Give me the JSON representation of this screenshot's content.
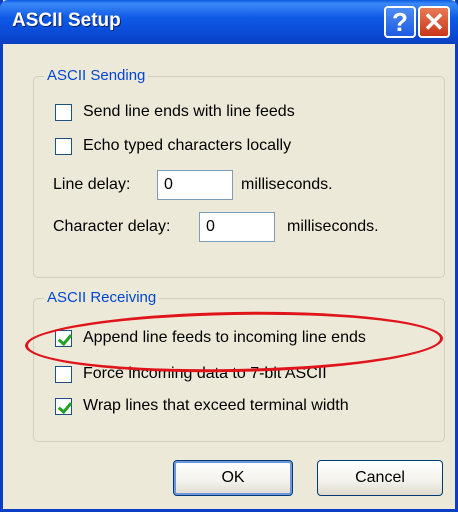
{
  "window": {
    "title": "ASCII Setup"
  },
  "titlebar": {
    "help_glyph": "?",
    "close_glyph": "✕"
  },
  "sending": {
    "legend": "ASCII Sending",
    "send_line_ends": {
      "label": "Send line ends with line feeds",
      "checked": false
    },
    "echo_typed": {
      "label": "Echo typed characters locally",
      "checked": false
    },
    "line_delay": {
      "label": "Line delay:",
      "value": "0",
      "unit": "milliseconds."
    },
    "char_delay": {
      "label": "Character delay:",
      "value": "0",
      "unit": "milliseconds."
    }
  },
  "receiving": {
    "legend": "ASCII Receiving",
    "append_line_feeds": {
      "label": "Append line feeds to incoming line ends",
      "checked": true
    },
    "force_7bit": {
      "label": "Force incoming data to 7-bit ASCII",
      "checked": false
    },
    "wrap_lines": {
      "label": "Wrap lines that exceed terminal width",
      "checked": true
    }
  },
  "buttons": {
    "ok": "OK",
    "cancel": "Cancel"
  },
  "annotation": {
    "color": "#e0151b"
  }
}
